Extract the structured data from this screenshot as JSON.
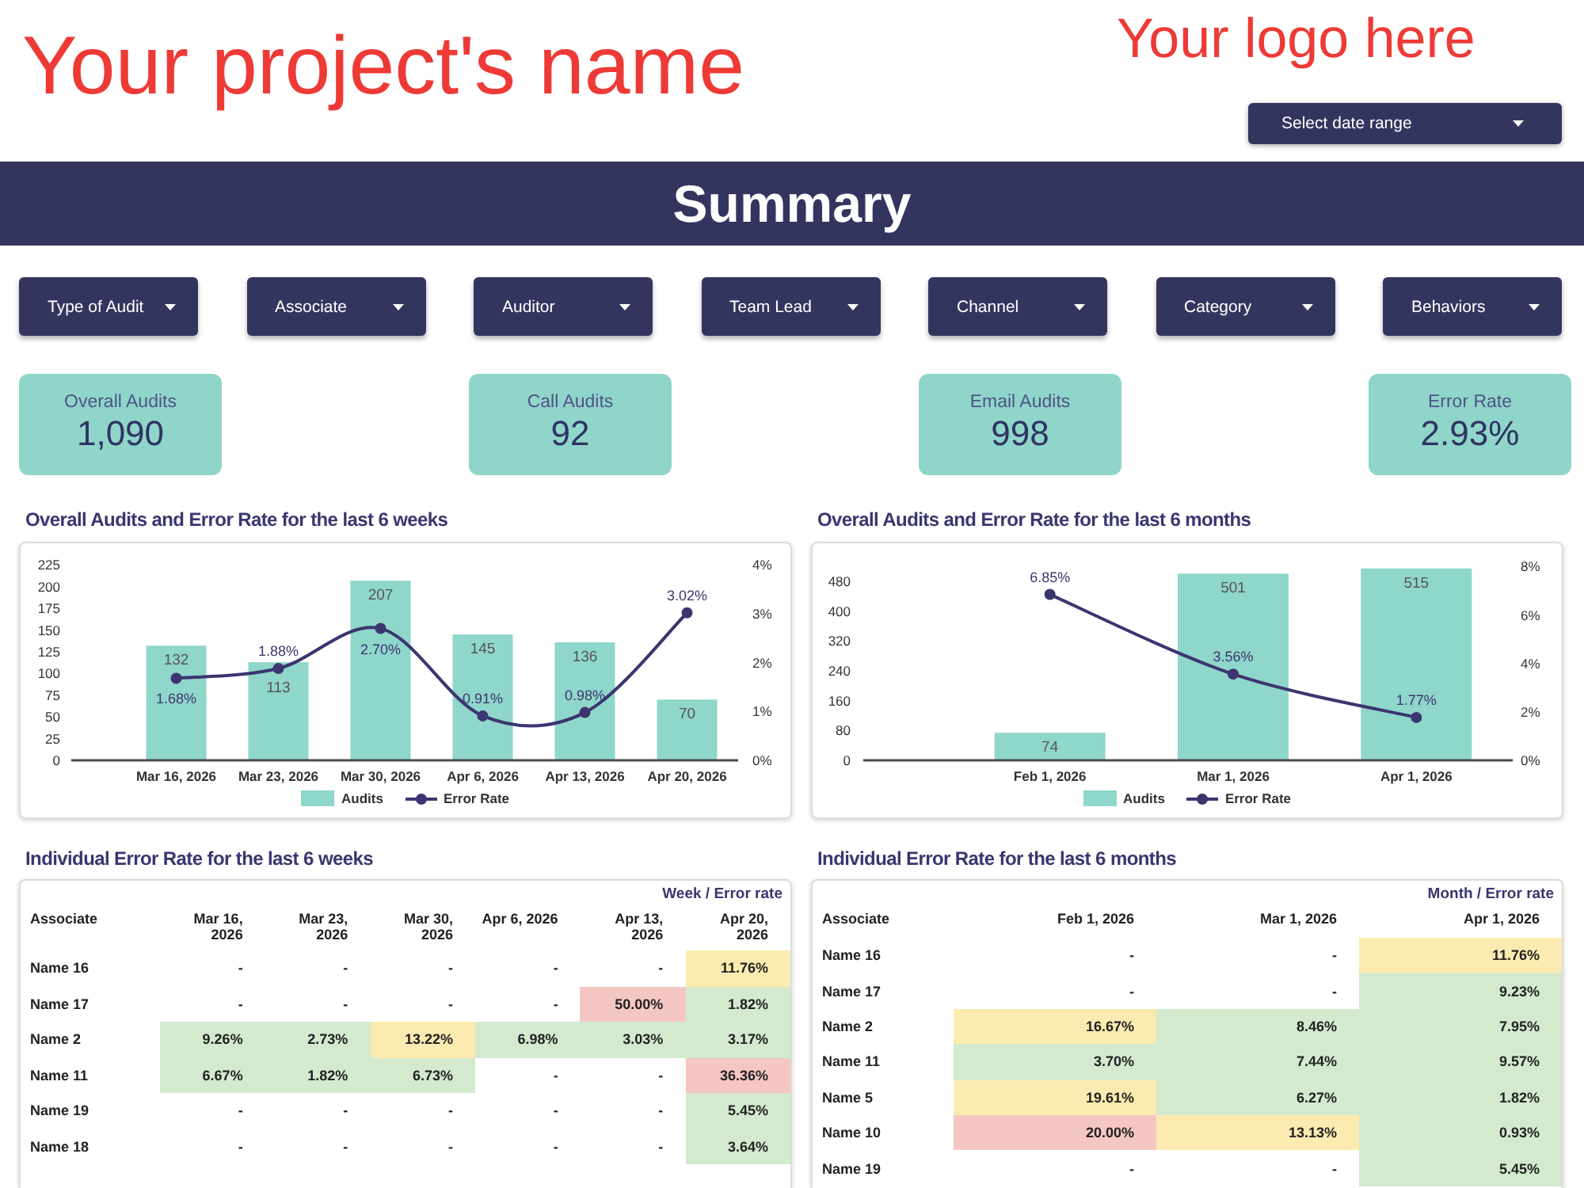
{
  "header": {
    "project_name": "Your project's name",
    "logo_text": "Your logo here",
    "date_range": {
      "label": "Select date range"
    }
  },
  "summary_title": "Summary",
  "filters": [
    "Type of Audit",
    "Associate",
    "Auditor",
    "Team Lead",
    "Channel",
    "Category",
    "Behaviors"
  ],
  "kpis": [
    {
      "label": "Overall Audits",
      "value": "1,090"
    },
    {
      "label": "Call Audits",
      "value": "92"
    },
    {
      "label": "Email Audits",
      "value": "998"
    },
    {
      "label": "Error Rate",
      "value": "2.93%"
    }
  ],
  "charts": [
    {
      "chart_data": {
        "type": "bar",
        "title": "Overall Audits and Error Rate for the last 6 weeks",
        "categories": [
          "Mar 16, 2026",
          "Mar 23, 2026",
          "Mar 30, 2026",
          "Apr 6, 2026",
          "Apr 13, 2026",
          "Apr 20, 2026"
        ],
        "series": [
          {
            "name": "Audits",
            "color": "#8fd6cb",
            "values": [
              132,
              113,
              207,
              145,
              136,
              70
            ],
            "value_labels": [
              "132",
              "113",
              "207",
              "145",
              "136",
              "70"
            ]
          },
          {
            "name": "Error Rate",
            "type": "line",
            "axis": "y2",
            "marker": "circle",
            "color": "#3b3570",
            "values": [
              1.68,
              1.88,
              2.7,
              0.91,
              0.98,
              3.02
            ],
            "value_labels": [
              "1.68%",
              "1.88%",
              "2.70%",
              "0.91%",
              "0.98%",
              "3.02%"
            ]
          }
        ],
        "ylim": [
          0,
          225
        ],
        "yticks": [
          0,
          25,
          50,
          75,
          100,
          125,
          150,
          175,
          200,
          225
        ],
        "y2lim": [
          0,
          4
        ],
        "y2ticks": [
          {
            "value": 0,
            "label": "0%"
          },
          {
            "value": 1,
            "label": "1%"
          },
          {
            "value": 2,
            "label": "2%"
          },
          {
            "value": 3,
            "label": "3%"
          },
          {
            "value": 4,
            "label": "4%"
          }
        ],
        "data_labels": true,
        "legend": "bottom"
      }
    },
    {
      "chart_data": {
        "type": "bar",
        "title": "Overall Audits and Error Rate for the last 6 months",
        "categories": [
          "Feb 1, 2026",
          "Mar 1, 2026",
          "Apr 1, 2026"
        ],
        "series": [
          {
            "name": "Audits",
            "color": "#8fd6cb",
            "values": [
              74,
              501,
              515
            ],
            "value_labels": [
              "74",
              "501",
              "515"
            ]
          },
          {
            "name": "Error Rate",
            "type": "line",
            "axis": "y2",
            "marker": "circle",
            "color": "#3b3570",
            "values": [
              6.85,
              3.56,
              1.77
            ],
            "value_labels": [
              "6.85%",
              "3.56%",
              "1.77%"
            ]
          }
        ],
        "ylim": [
          0,
          520
        ],
        "yticks": [
          0,
          80,
          160,
          240,
          320,
          400,
          480
        ],
        "y2lim": [
          0,
          8
        ],
        "y2ticks": [
          {
            "value": 0,
            "label": "0%"
          },
          {
            "value": 2,
            "label": "2%"
          },
          {
            "value": 4,
            "label": "4%"
          },
          {
            "value": 6,
            "label": "6%"
          },
          {
            "value": 8,
            "label": "8%"
          }
        ],
        "data_labels": true,
        "legend": "bottom"
      }
    }
  ],
  "tables": [
    {
      "title": "Individual Error Rate for the last 6 weeks",
      "header_note": "Week / Error rate",
      "columns": [
        "Associate",
        "Mar 16, 2026",
        "Mar 23, 2026",
        "Mar 30, 2026",
        "Apr 6, 2026",
        "Apr 13, 2026",
        "Apr 20, 2026"
      ],
      "rows": [
        {
          "cells": [
            {
              "text": "Name 16"
            },
            {
              "text": "-",
              "color": "#ffffff"
            },
            {
              "text": "-",
              "color": "#ffffff"
            },
            {
              "text": "-",
              "color": "#ffffff"
            },
            {
              "text": "-",
              "color": "#ffffff"
            },
            {
              "text": "-",
              "color": "#ffffff"
            },
            {
              "text": "11.76%",
              "color": "#fcebb0"
            }
          ]
        },
        {
          "cells": [
            {
              "text": "Name 17"
            },
            {
              "text": "-",
              "color": "#ffffff"
            },
            {
              "text": "-",
              "color": "#ffffff"
            },
            {
              "text": "-",
              "color": "#ffffff"
            },
            {
              "text": "-",
              "color": "#ffffff"
            },
            {
              "text": "50.00%",
              "color": "#f5c7c3"
            },
            {
              "text": "1.82%",
              "color": "#d3eacf"
            }
          ]
        },
        {
          "cells": [
            {
              "text": "Name 2"
            },
            {
              "text": "9.26%",
              "color": "#d3eacf"
            },
            {
              "text": "2.73%",
              "color": "#d3eacf"
            },
            {
              "text": "13.22%",
              "color": "#fcebb0"
            },
            {
              "text": "6.98%",
              "color": "#d3eacf"
            },
            {
              "text": "3.03%",
              "color": "#d3eacf"
            },
            {
              "text": "3.17%",
              "color": "#d3eacf"
            }
          ]
        },
        {
          "cells": [
            {
              "text": "Name 11"
            },
            {
              "text": "6.67%",
              "color": "#d3eacf"
            },
            {
              "text": "1.82%",
              "color": "#d3eacf"
            },
            {
              "text": "6.73%",
              "color": "#d3eacf"
            },
            {
              "text": "-",
              "color": "#ffffff"
            },
            {
              "text": "-",
              "color": "#ffffff"
            },
            {
              "text": "36.36%",
              "color": "#f5c7c3"
            }
          ]
        },
        {
          "cells": [
            {
              "text": "Name 19"
            },
            {
              "text": "-",
              "color": "#ffffff"
            },
            {
              "text": "-",
              "color": "#ffffff"
            },
            {
              "text": "-",
              "color": "#ffffff"
            },
            {
              "text": "-",
              "color": "#ffffff"
            },
            {
              "text": "-",
              "color": "#ffffff"
            },
            {
              "text": "5.45%",
              "color": "#d3eacf"
            }
          ]
        },
        {
          "cells": [
            {
              "text": "Name 18"
            },
            {
              "text": "-",
              "color": "#ffffff"
            },
            {
              "text": "-",
              "color": "#ffffff"
            },
            {
              "text": "-",
              "color": "#ffffff"
            },
            {
              "text": "-",
              "color": "#ffffff"
            },
            {
              "text": "-",
              "color": "#ffffff"
            },
            {
              "text": "3.64%",
              "color": "#d3eacf"
            }
          ]
        }
      ]
    },
    {
      "title": "Individual Error Rate for the last 6 months",
      "header_note": "Month / Error rate",
      "columns": [
        "Associate",
        "Feb 1, 2026",
        "Mar 1, 2026",
        "Apr 1, 2026"
      ],
      "rows": [
        {
          "cells": [
            {
              "text": "Name 16"
            },
            {
              "text": "-",
              "color": "#ffffff"
            },
            {
              "text": "-",
              "color": "#ffffff"
            },
            {
              "text": "11.76%",
              "color": "#fcebb0"
            }
          ]
        },
        {
          "cells": [
            {
              "text": "Name 17"
            },
            {
              "text": "-",
              "color": "#ffffff"
            },
            {
              "text": "-",
              "color": "#ffffff"
            },
            {
              "text": "9.23%",
              "color": "#d3eacf"
            }
          ]
        },
        {
          "cells": [
            {
              "text": "Name 2"
            },
            {
              "text": "16.67%",
              "color": "#fcebb0"
            },
            {
              "text": "8.46%",
              "color": "#d3eacf"
            },
            {
              "text": "7.95%",
              "color": "#d3eacf"
            }
          ]
        },
        {
          "cells": [
            {
              "text": "Name 11"
            },
            {
              "text": "3.70%",
              "color": "#d3eacf"
            },
            {
              "text": "7.44%",
              "color": "#d3eacf"
            },
            {
              "text": "9.57%",
              "color": "#d3eacf"
            }
          ]
        },
        {
          "cells": [
            {
              "text": "Name 5"
            },
            {
              "text": "19.61%",
              "color": "#fcebb0"
            },
            {
              "text": "6.27%",
              "color": "#d3eacf"
            },
            {
              "text": "1.82%",
              "color": "#d3eacf"
            }
          ]
        },
        {
          "cells": [
            {
              "text": "Name 10"
            },
            {
              "text": "20.00%",
              "color": "#f5c7c3"
            },
            {
              "text": "13.13%",
              "color": "#fcebb0"
            },
            {
              "text": "0.93%",
              "color": "#d3eacf"
            }
          ]
        },
        {
          "cells": [
            {
              "text": "Name 19"
            },
            {
              "text": "-",
              "color": "#ffffff"
            },
            {
              "text": "-",
              "color": "#ffffff"
            },
            {
              "text": "5.45%",
              "color": "#d3eacf"
            }
          ]
        }
      ]
    }
  ]
}
